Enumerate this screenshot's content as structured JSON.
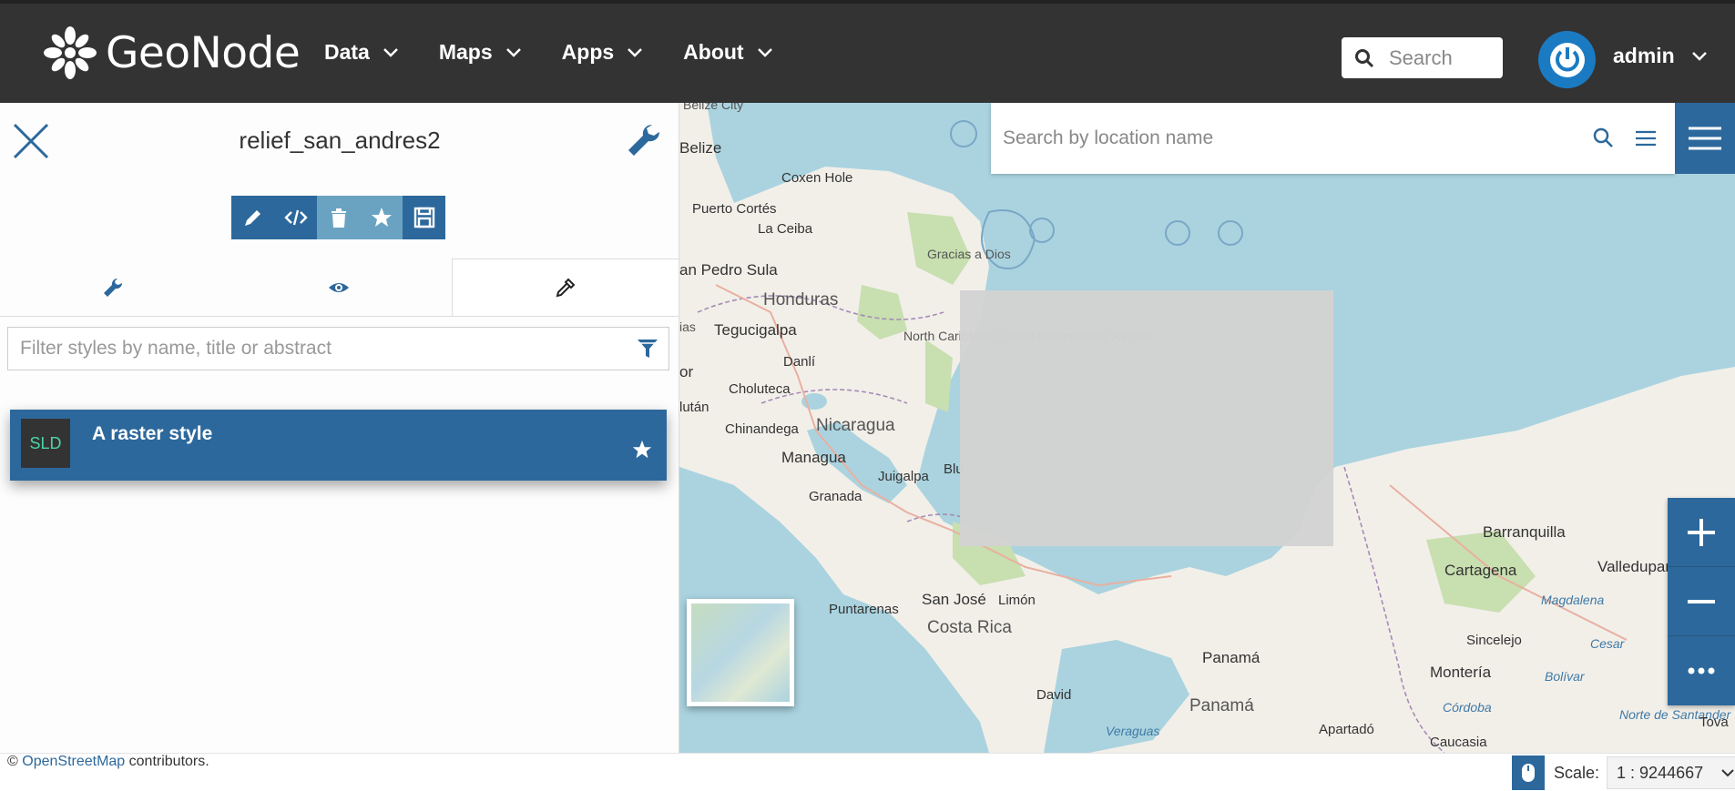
{
  "app": {
    "logo_text": "GeoNode"
  },
  "nav": {
    "items": [
      {
        "label": "Data"
      },
      {
        "label": "Maps"
      },
      {
        "label": "Apps"
      },
      {
        "label": "About"
      }
    ],
    "search_placeholder": "Search",
    "user": "admin",
    "icons": [
      "flower-logo-icon",
      "chevron-down-icon",
      "search-icon",
      "power-icon"
    ]
  },
  "panel": {
    "title": "relief_san_andres2",
    "toolbar": [
      "edit-icon",
      "code-icon",
      "trash-icon",
      "star-icon",
      "save-icon"
    ],
    "tabs": [
      "wrench-icon",
      "eye-icon",
      "eyedropper-icon"
    ],
    "active_tab": 2,
    "filter_placeholder": "Filter styles by name, title or abstract",
    "styles": [
      {
        "badge": "SLD",
        "name": "A raster style"
      }
    ]
  },
  "map": {
    "search_placeholder": "Search by location name",
    "labels": {
      "belize_city": "Belize City",
      "belize": "Belize",
      "coxen_hole": "Coxen Hole",
      "puerto_cortes": "Puerto Cortés",
      "la_ceiba": "La Ceiba",
      "gracias_a_dios": "Gracias a Dios",
      "san_pedro_sula": "an Pedro Sula",
      "honduras": "Honduras",
      "tegucigalpa": "Tegucigalpa",
      "north_caribbean": "North Caribbean Coast Autonomous Region",
      "danli": "Danlí",
      "choluteca": "Choluteca",
      "chinandega": "Chinandega",
      "nicaragua": "Nicaragua",
      "managua": "Managua",
      "juigalpa": "Juigalpa",
      "granada": "Granada",
      "bluefields": "Blu",
      "puntarenas": "Puntarenas",
      "san_jose": "San José",
      "limon": "Limón",
      "costa_rica": "Costa Rica",
      "david": "David",
      "panama_city": "Panamá",
      "panama": "Panamá",
      "veraguas": "Veraguas",
      "barranquilla": "Barranquilla",
      "cartagena": "Cartagena",
      "valledupar": "Valledupar",
      "magdalena": "Magdalena",
      "sincelejo": "Sincelejo",
      "monteria": "Montería",
      "bolivar": "Bolívar",
      "cesar": "Cesar",
      "cordoba": "Córdoba",
      "apartado": "Apartadó",
      "caucasia": "Caucasia",
      "norte_de_santander": "Norte de Santander",
      "tovar": "Tova",
      "lutan": "lután",
      "or": "or",
      "ias": "ias"
    },
    "controls": [
      "menu-icon",
      "plus-icon",
      "minus-icon",
      "more-icon"
    ]
  },
  "footer": {
    "attribution_prefix": "©",
    "attribution_link": "OpenStreetMap",
    "attribution_suffix": "contributors.",
    "scale_label": "Scale:",
    "scale_value": "1 : 9244667"
  },
  "colors": {
    "nav_bg": "#333333",
    "accent": "#2c689c",
    "water": "#aad3df",
    "land": "#f2efe9"
  }
}
